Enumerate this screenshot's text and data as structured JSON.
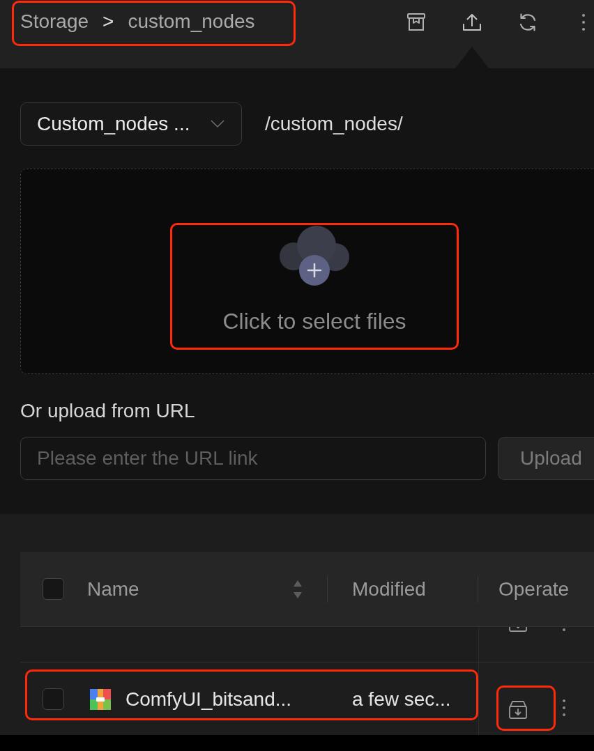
{
  "toolbar": {
    "breadcrumb": {
      "items": [
        {
          "label": "Storage"
        },
        {
          "label": "custom_nodes"
        }
      ],
      "separator": ">",
      "highlighted": true
    },
    "actions": [
      {
        "kind": "archive",
        "expanded": false
      },
      {
        "kind": "upload",
        "expanded": true
      },
      {
        "kind": "refresh",
        "expanded": false
      },
      {
        "kind": "more",
        "expanded": false
      }
    ]
  },
  "upload_panel": {
    "folder_select": {
      "value": "Custom_nodes ..."
    },
    "path": "/custom_nodes/",
    "dropzone": {
      "prompt": "Click to select files",
      "highlighted": true
    },
    "url_label": "Or upload from URL",
    "url_field": {
      "placeholder": "Please enter the URL link"
    },
    "upload_button": {
      "label": "Upload",
      "disabled": true
    }
  },
  "file_table": {
    "select_all_checked": false,
    "columns": [
      {
        "kind": "name",
        "label": "Name",
        "sortable": true
      },
      {
        "kind": "modified",
        "label": "Modified",
        "sortable": false
      },
      {
        "kind": "operate",
        "label": "Operate",
        "sortable": false
      }
    ],
    "rows": [
      {
        "kind": "clipped"
      },
      {
        "kind": "file",
        "checked": false,
        "name": "ComfyUI_bitsand...",
        "modified": "a few sec...",
        "highlighted": true,
        "actions_highlighted": true
      }
    ]
  }
}
